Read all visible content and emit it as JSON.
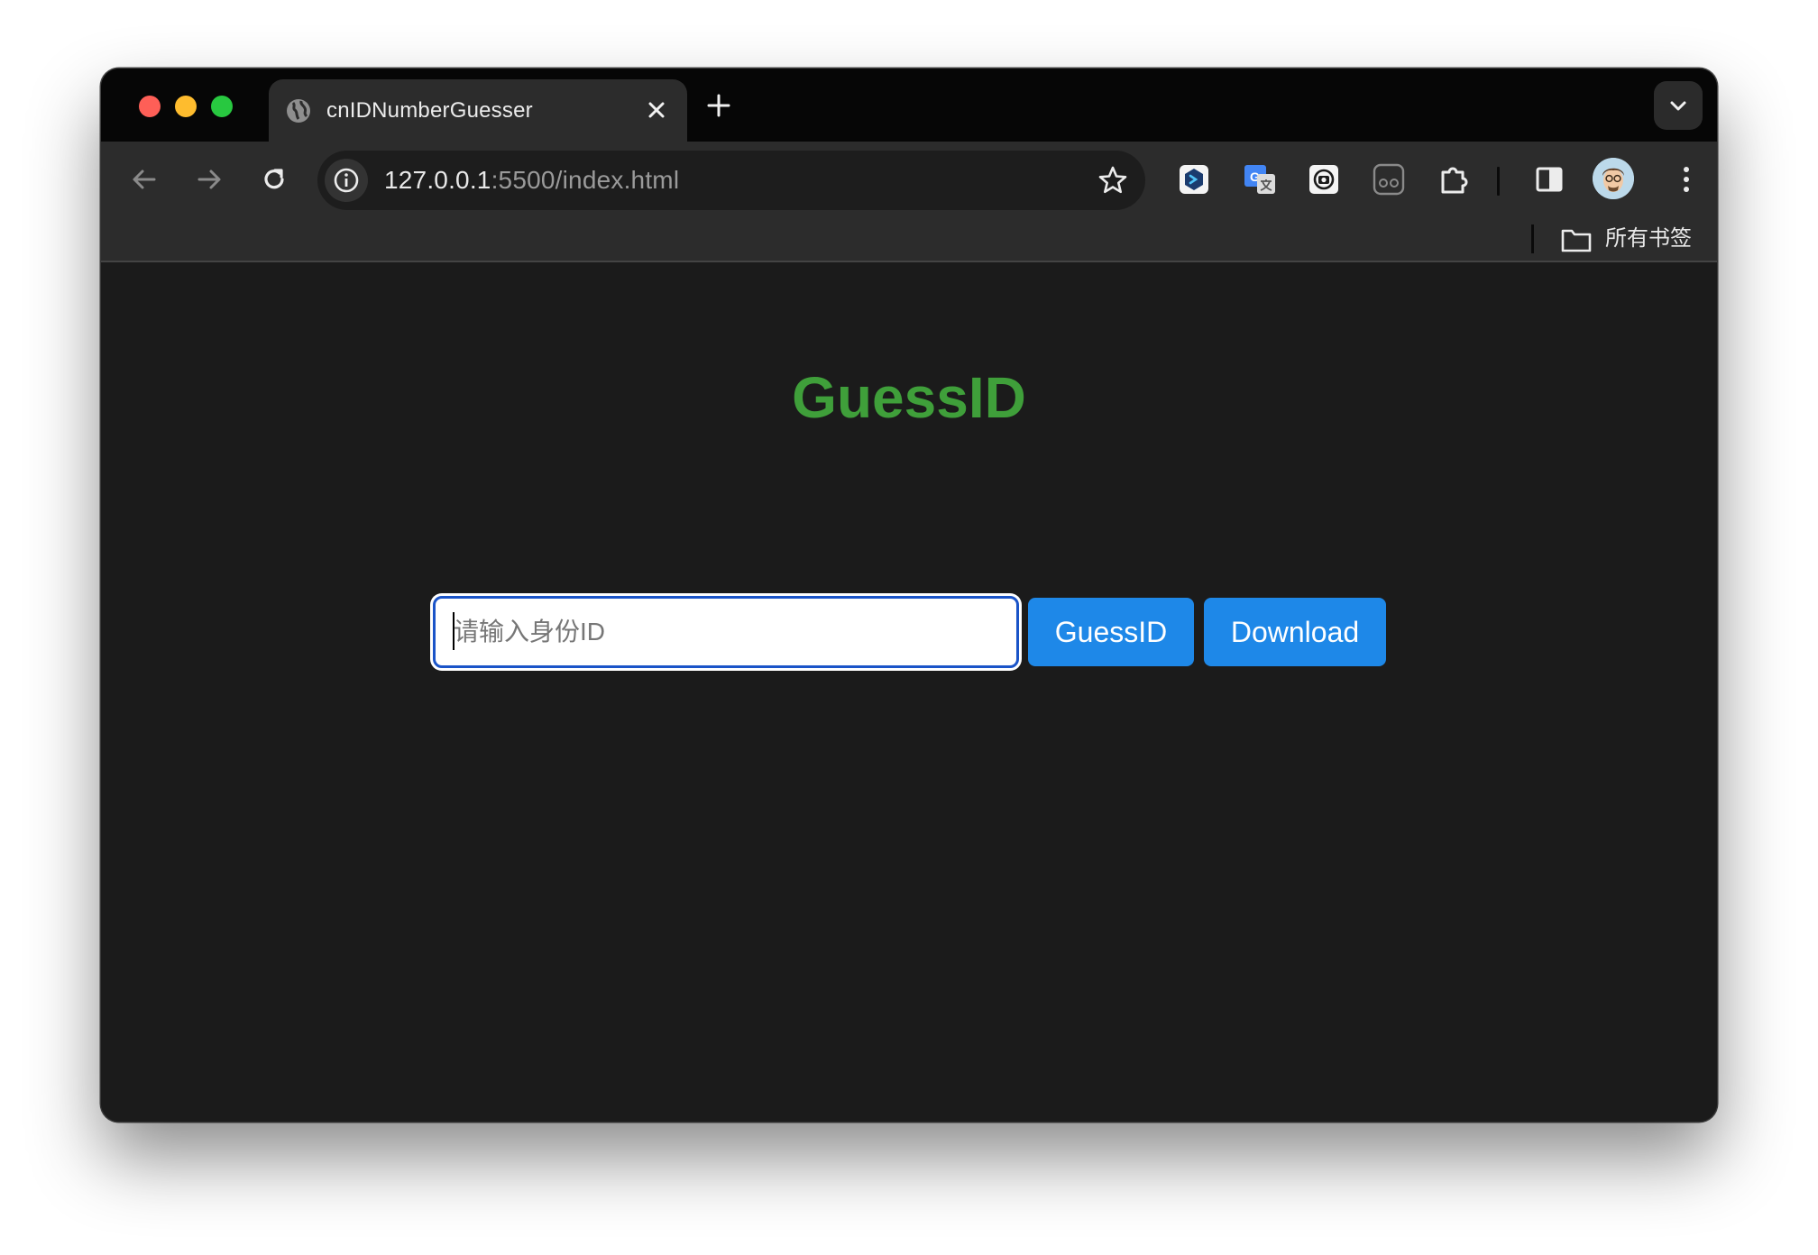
{
  "browser": {
    "tab": {
      "title": "cnIDNumberGuesser",
      "favicon": "globe-icon"
    },
    "address_bar": {
      "host": "127.0.0.1",
      "path": ":5500/index.html"
    },
    "bookmarks_bar": {
      "all_bookmarks_label": "所有书签"
    },
    "extensions": [
      "dev-extension-icon",
      "google-translate-icon",
      "screenshot-extension-icon",
      "reader-extension-icon",
      "extensions-puzzle-icon"
    ],
    "icons": {
      "back": "back-arrow-icon",
      "forward": "forward-arrow-icon",
      "reload": "reload-icon",
      "info": "site-info-icon",
      "bookmark_star": "star-icon",
      "side_panel": "side-panel-icon",
      "profile": "avatar",
      "menu": "kebab-menu-icon",
      "tab_search": "chevron-down-icon",
      "new_tab": "plus-icon",
      "close_tab": "close-icon",
      "bookmark_folder": "folder-icon"
    }
  },
  "page": {
    "title": "GuessID",
    "id_input": {
      "placeholder": "请输入身份ID",
      "value": ""
    },
    "guess_button_label": "GuessID",
    "download_button_label": "Download"
  },
  "colors": {
    "title_green": "#3f9f3a",
    "button_blue": "#1e88e8",
    "input_focus_border": "#1a54c8",
    "page_background": "#1b1b1b"
  }
}
